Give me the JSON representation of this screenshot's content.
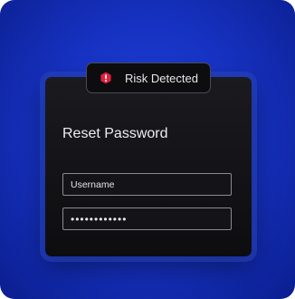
{
  "alert": {
    "icon": "exclamation-icon",
    "text": "Risk Detected",
    "icon_color": "#e0203a"
  },
  "form": {
    "title": "Reset Password",
    "username": {
      "placeholder": "Username",
      "value": ""
    },
    "password": {
      "value": "••••••••••••"
    }
  },
  "colors": {
    "background_accent": "#1733c4",
    "card": "#111114"
  }
}
